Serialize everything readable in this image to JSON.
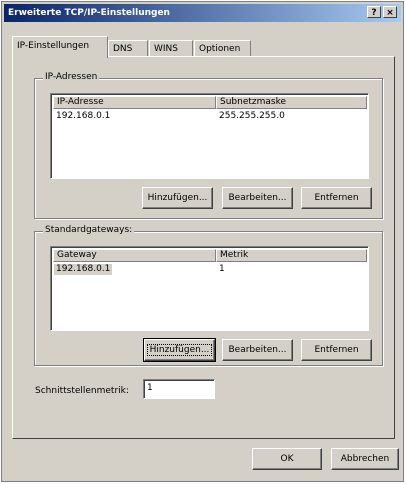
{
  "window": {
    "title": "Erweiterte TCP/IP-Einstellungen",
    "help_button": "?",
    "close_button": "×"
  },
  "tabs": [
    {
      "label": "IP-Einstellungen",
      "active": true
    },
    {
      "label": "DNS",
      "active": false
    },
    {
      "label": "WINS",
      "active": false
    },
    {
      "label": "Optionen",
      "active": false
    }
  ],
  "ip_group": {
    "title": "IP-Adressen",
    "columns": [
      "IP-Adresse",
      "Subnetzmaske"
    ],
    "rows": [
      [
        "192.168.0.1",
        "255.255.255.0"
      ]
    ],
    "add_label": "Hinzufügen...",
    "edit_label": "Bearbeiten...",
    "remove_label": "Entfernen"
  },
  "gateway_group": {
    "title": "Standardgateways:",
    "columns": [
      "Gateway",
      "Metrik"
    ],
    "rows": [
      [
        "192.168.0.1",
        "1"
      ]
    ],
    "add_label": "Hinzufügen...",
    "edit_label": "Bearbeiten...",
    "remove_label": "Entfernen"
  },
  "metric": {
    "label": "Schnittstellenmetrik:",
    "value": "1"
  },
  "footer": {
    "ok_label": "OK",
    "cancel_label": "Abbrechen"
  }
}
